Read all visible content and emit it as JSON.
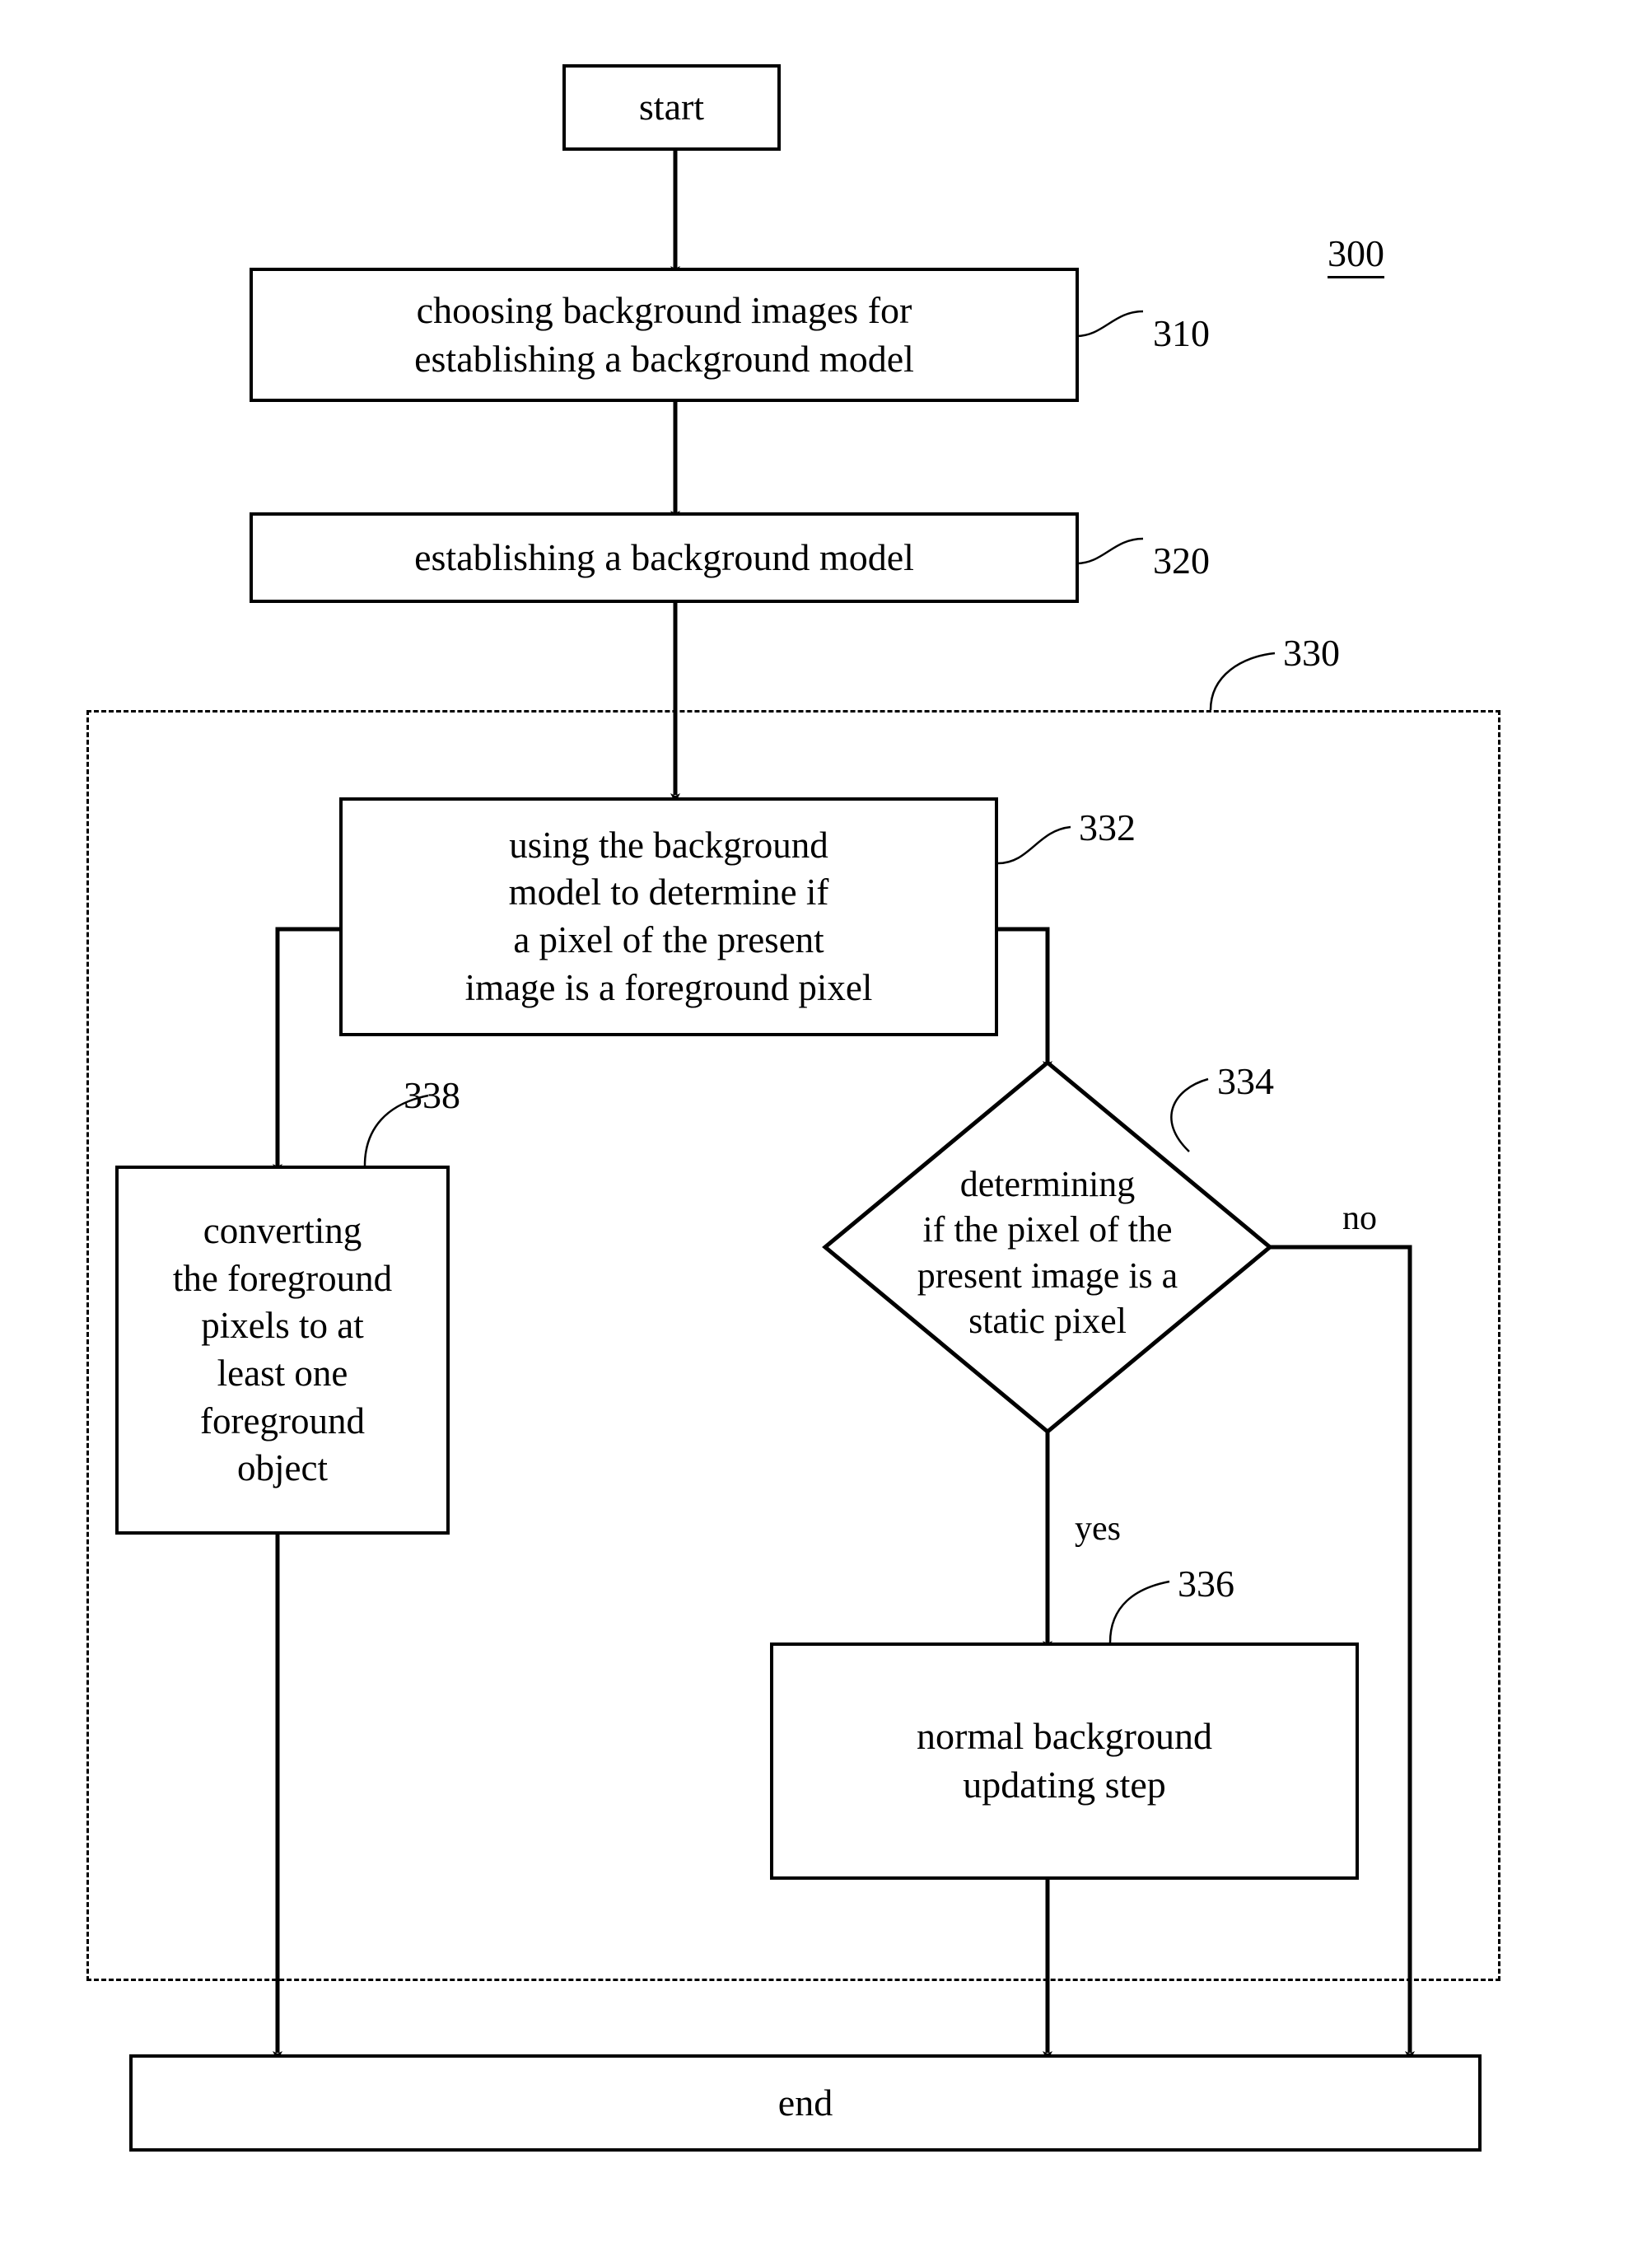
{
  "figure": {
    "number": "300",
    "type": "patent-flowchart"
  },
  "nodes": {
    "start": {
      "label": "start",
      "ref": null
    },
    "step310": {
      "label": "choosing background images for\nestablishing a background model",
      "ref": "310"
    },
    "step320": {
      "label": "establishing a background model",
      "ref": "320"
    },
    "group330": {
      "ref": "330"
    },
    "step332": {
      "label": "using the background\nmodel to determine if\na pixel of the present\nimage is a foreground pixel",
      "ref": "332"
    },
    "step338": {
      "label": "converting\nthe foreground\npixels to at\nleast one\nforeground\nobject",
      "ref": "338"
    },
    "decision334": {
      "label": "determining\nif the pixel of the\npresent image is a\nstatic pixel",
      "ref": "334"
    },
    "step336": {
      "label": "normal background\nupdating step",
      "ref": "336"
    },
    "end": {
      "label": "end",
      "ref": null
    }
  },
  "edges": {
    "decision_no": "no",
    "decision_yes": "yes"
  },
  "colors": {
    "stroke": "#000000",
    "fill": "#ffffff"
  }
}
